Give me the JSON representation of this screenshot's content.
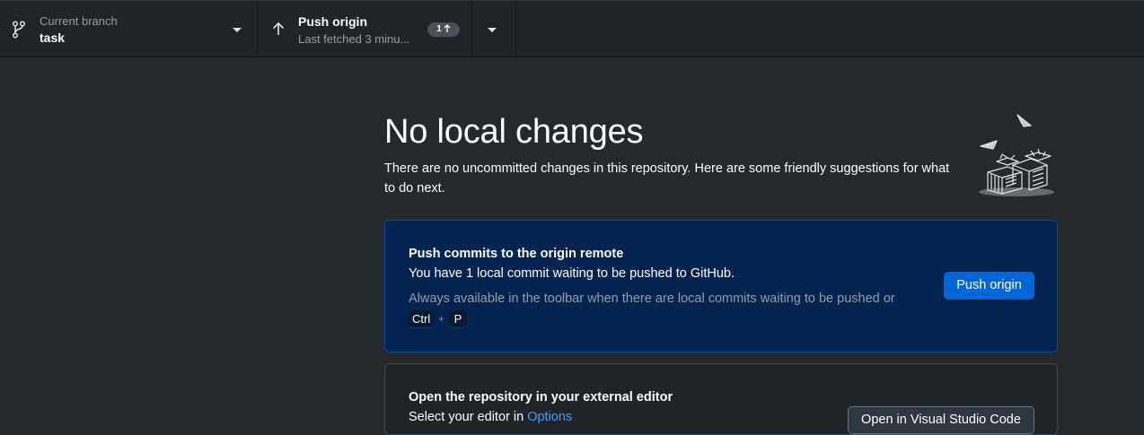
{
  "toolbar": {
    "branch": {
      "label": "Current branch",
      "value": "task"
    },
    "push": {
      "label": "Push origin",
      "sublabel": "Last fetched 3 minu...",
      "badge_count": "1"
    }
  },
  "main": {
    "title": "No local changes",
    "subtitle": "There are no uncommitted changes in this repository. Here are some friendly suggestions for what to do next."
  },
  "push_card": {
    "title": "Push commits to the origin remote",
    "description": "You have 1 local commit waiting to be pushed to GitHub.",
    "hint": "Always available in the toolbar when there are local commits waiting to be pushed or",
    "shortcut_key1": "Ctrl",
    "shortcut_plus": "+",
    "shortcut_key2": "P",
    "button_label": "Push origin"
  },
  "editor_card": {
    "title": "Open the repository in your external editor",
    "description_prefix": "Select your editor in ",
    "description_link": "Options",
    "button_label": "Open in Visual Studio Code"
  },
  "icons": {
    "branch": "git-branch-icon",
    "push": "arrow-up-icon",
    "caret": "chevron-down-icon",
    "illustration": "empty-repository-illustration"
  },
  "colors": {
    "background": "#24292e",
    "toolbar": "#1f2428",
    "accent": "#0366d6",
    "push_card_bg": "#032451",
    "link": "#4a9cf5"
  }
}
